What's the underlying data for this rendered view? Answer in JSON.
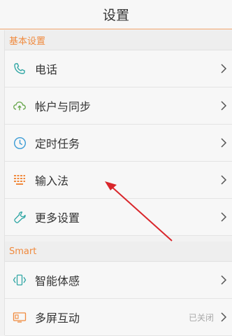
{
  "header": {
    "title": "设置"
  },
  "sections": [
    {
      "title": "基本设置",
      "items": [
        {
          "label": "电话",
          "icon": "phone-icon"
        },
        {
          "label": "帐户与同步",
          "icon": "cloud-sync-icon"
        },
        {
          "label": "定时任务",
          "icon": "clock-icon"
        },
        {
          "label": "输入法",
          "icon": "keyboard-icon"
        },
        {
          "label": "更多设置",
          "icon": "wrench-icon"
        }
      ]
    },
    {
      "title": "Smart",
      "items": [
        {
          "label": "智能体感",
          "icon": "motion-sense-icon"
        },
        {
          "label": "多屏互动",
          "icon": "multi-screen-icon",
          "status": "已关闭"
        }
      ]
    }
  ],
  "colors": {
    "accent": "#f08a3e",
    "icon_teal": "#2fa6a4",
    "icon_green": "#6aa84f",
    "icon_blue": "#3a9bd5",
    "icon_orange": "#f08a3e",
    "annotation_red": "#d9262b"
  }
}
